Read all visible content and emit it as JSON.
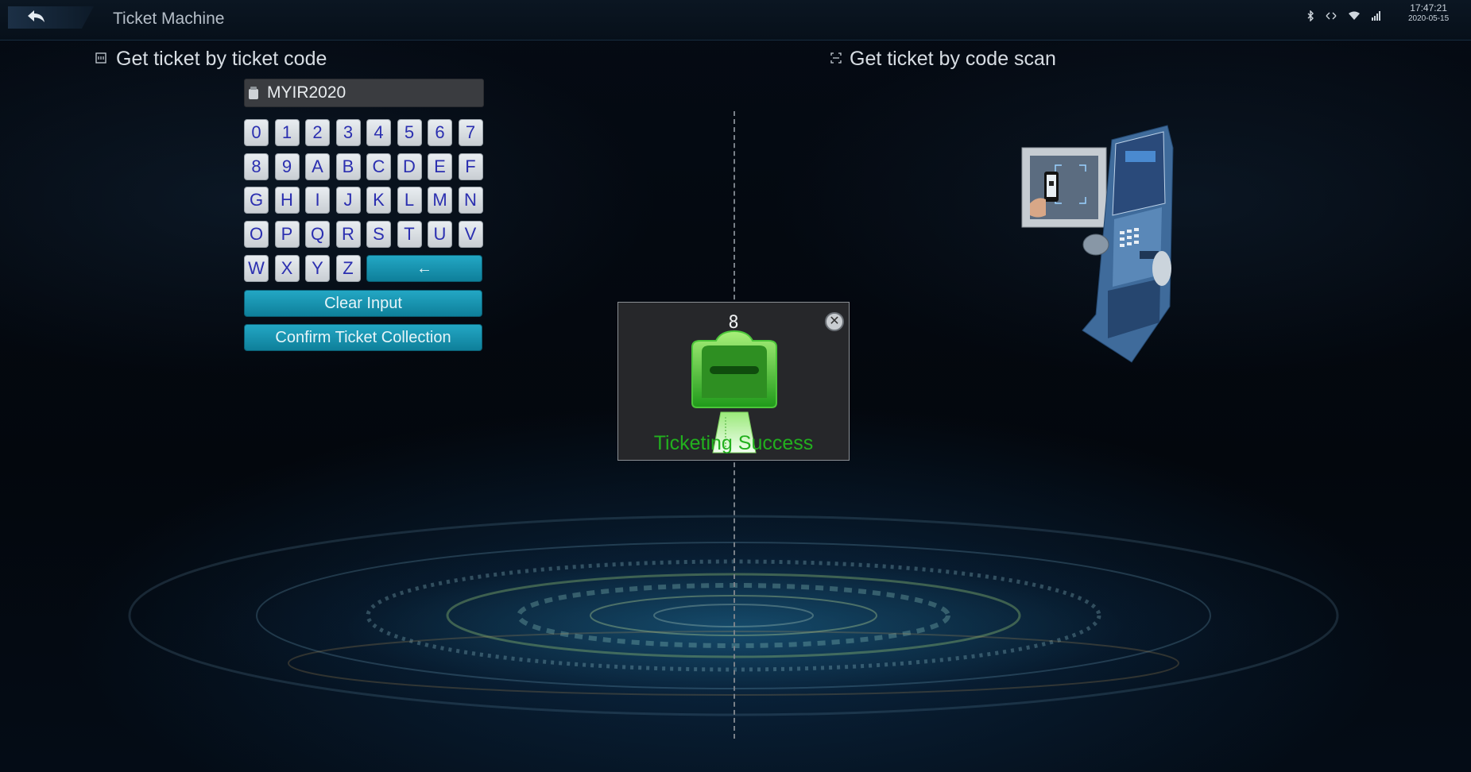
{
  "header": {
    "title": "Ticket Machine",
    "time": "17:47:21",
    "date": "2020-05-15",
    "status_icons": [
      "bluetooth-icon",
      "network-arrows-icon",
      "wifi-icon",
      "signal-bars-icon"
    ]
  },
  "ticket_code_section": {
    "title": "Get ticket by ticket code",
    "input_value": "MYIR2020",
    "keys": [
      "0",
      "1",
      "2",
      "3",
      "4",
      "5",
      "6",
      "7",
      "8",
      "9",
      "A",
      "B",
      "C",
      "D",
      "E",
      "F",
      "G",
      "H",
      "I",
      "J",
      "K",
      "L",
      "M",
      "N",
      "O",
      "P",
      "Q",
      "R",
      "S",
      "T",
      "U",
      "V",
      "W",
      "X",
      "Y",
      "Z"
    ],
    "backspace_label": "←",
    "clear_label": "Clear Input",
    "confirm_label": "Confirm Ticket Collection"
  },
  "scan_section": {
    "title": "Get ticket by code scan"
  },
  "dialog": {
    "countdown": "8",
    "message": "Ticketing Success",
    "close_symbol": "✕"
  },
  "colors": {
    "accent": "#1a9ab8",
    "success": "#22b01e",
    "key_text": "#2b2fb0"
  }
}
